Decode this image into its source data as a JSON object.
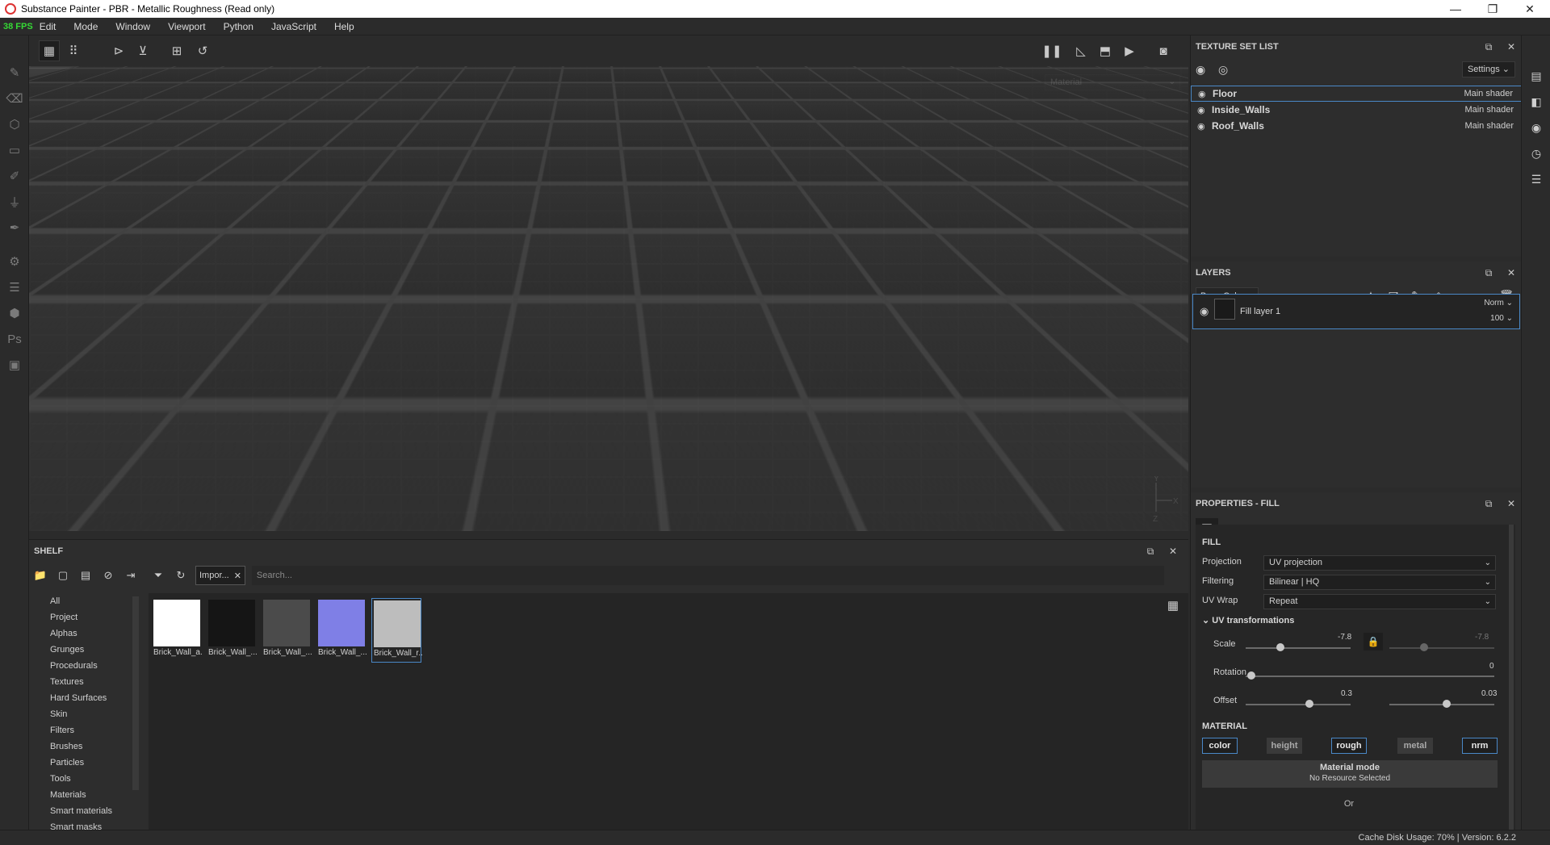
{
  "window": {
    "title": "Substance Painter - PBR - Metallic Roughness (Read only)",
    "minimize": "—",
    "maximize": "❐",
    "close": "✕"
  },
  "menubar": {
    "fps": "38 FPS",
    "items": [
      "Edit",
      "Mode",
      "Window",
      "Viewport",
      "Python",
      "JavaScript",
      "Help"
    ]
  },
  "viewport": {
    "material_select": "Material",
    "axis": {
      "y": "Y",
      "x": "X",
      "z": "Z"
    }
  },
  "shelf": {
    "title": "SHELF",
    "tag_chip": "Impor...",
    "search_placeholder": "Search...",
    "categories": [
      "All",
      "Project",
      "Alphas",
      "Grunges",
      "Procedurals",
      "Textures",
      "Hard Surfaces",
      "Skin",
      "Filters",
      "Brushes",
      "Particles",
      "Tools",
      "Materials",
      "Smart materials",
      "Smart masks"
    ],
    "thumbnails": [
      {
        "label": "Brick_Wall_a...",
        "color": "#ffffff"
      },
      {
        "label": "Brick_Wall_...",
        "color": "#151515"
      },
      {
        "label": "Brick_Wall_...",
        "color": "#4b4b4b"
      },
      {
        "label": "Brick_Wall_...",
        "color": "#7f7fe6"
      },
      {
        "label": "Brick_Wall_r...",
        "color": "#bdbdbd"
      }
    ]
  },
  "texture_set_list": {
    "title": "TEXTURE SET LIST",
    "settings": "Settings",
    "rows": [
      {
        "name": "Floor",
        "shader": "Main shader"
      },
      {
        "name": "Inside_Walls",
        "shader": "Main shader"
      },
      {
        "name": "Roof_Walls",
        "shader": "Main shader"
      }
    ]
  },
  "layers": {
    "title": "LAYERS",
    "channel": "Base Color",
    "layer": {
      "name": "Fill layer 1",
      "blend": "Norm",
      "opacity": "100"
    }
  },
  "properties": {
    "title": "PROPERTIES - FILL",
    "fill_title": "FILL",
    "projection_label": "Projection",
    "projection_value": "UV projection",
    "filtering_label": "Filtering",
    "filtering_value": "Bilinear | HQ",
    "uvwrap_label": "UV Wrap",
    "uvwrap_value": "Repeat",
    "uv_transformations": "UV transformations",
    "scale_label": "Scale",
    "scale_value": "-7.8",
    "scale_value2": "-7.8",
    "rotation_label": "Rotation",
    "rotation_value": "0",
    "offset_label": "Offset",
    "offset_value": "0.3",
    "offset_value2": "0.03",
    "material_title": "MATERIAL",
    "material_buttons": [
      {
        "label": "color",
        "on": true
      },
      {
        "label": "height",
        "on": false
      },
      {
        "label": "rough",
        "on": true
      },
      {
        "label": "metal",
        "on": false
      },
      {
        "label": "nrm",
        "on": true
      }
    ],
    "material_mode": "Material mode",
    "no_resource": "No Resource Selected",
    "or": "Or"
  },
  "statusbar": {
    "text": "Cache Disk Usage:   70% | Version: 6.2.2"
  },
  "colors": {
    "accent": "#4a88c7",
    "fps_green": "#35d935"
  }
}
